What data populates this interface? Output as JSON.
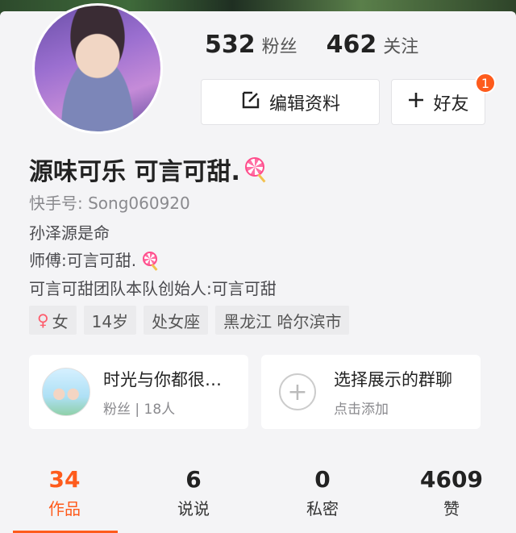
{
  "profile": {
    "followers_count": "532",
    "followers_label": "粉丝",
    "following_count": "462",
    "following_label": "关注",
    "name": "源味可乐 可言可甜.",
    "kuaishou_id": "快手号: Song060920",
    "bio": [
      "孙泽源是命",
      "师傅:可言可甜.",
      "可言可甜团队本队创始人:可言可甜"
    ],
    "tags": {
      "gender": "女",
      "age": "14岁",
      "zodiac": "处女座",
      "location": "黑龙江 哈尔滨市"
    }
  },
  "actions": {
    "edit_label": "编辑资料",
    "friend_label": "好友",
    "friend_badge": "1"
  },
  "group_card": {
    "title": "时光与你都很…",
    "subtitle": "粉丝 | 18人"
  },
  "add_group_card": {
    "title": "选择展示的群聊",
    "subtitle": "点击添加"
  },
  "tabs": [
    {
      "count": "34",
      "label": "作品"
    },
    {
      "count": "6",
      "label": "说说"
    },
    {
      "count": "0",
      "label": "私密"
    },
    {
      "count": "4609",
      "label": "赞"
    }
  ],
  "colors": {
    "accent": "#fe5b1c",
    "background": "#f4f4f6"
  }
}
